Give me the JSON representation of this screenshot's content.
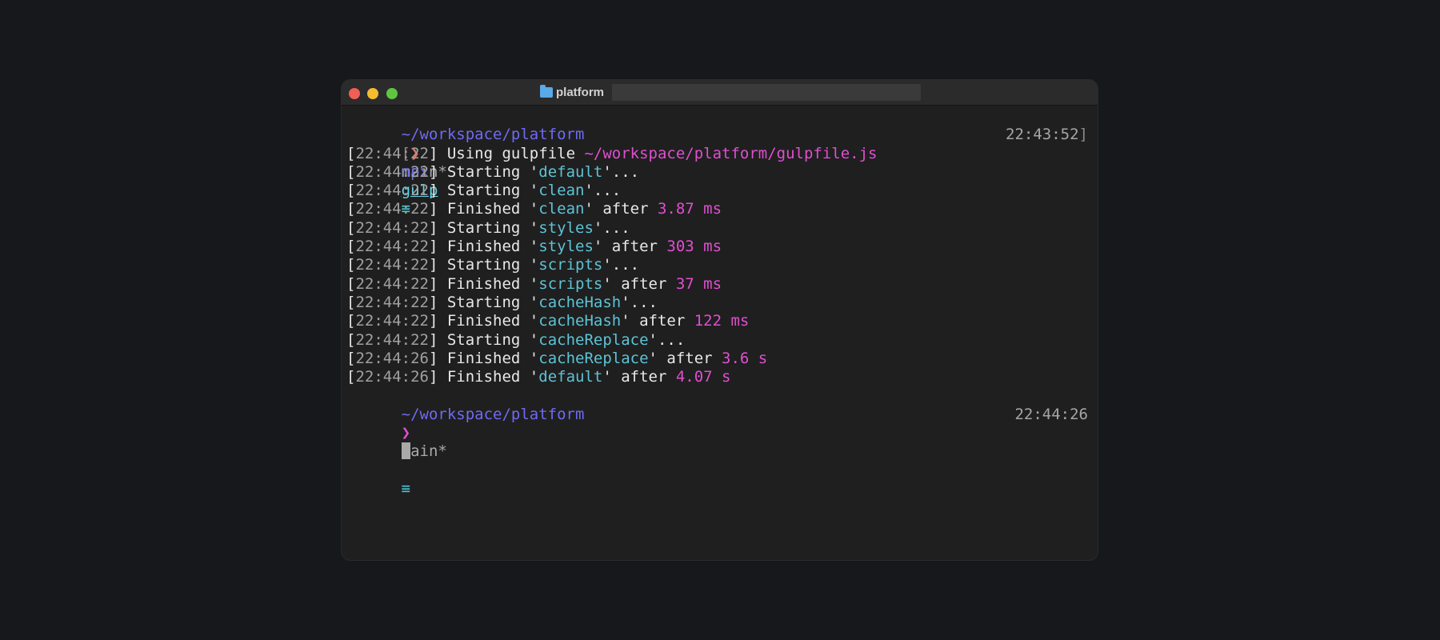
{
  "window": {
    "title": "platform",
    "colors": {
      "background": "#1f1f1f",
      "titlebar": "#2b2b2c",
      "path": "#6f6af2",
      "task": "#5dc3d6",
      "duration": "#e04fd0",
      "timestamp": "#a0a0a0"
    }
  },
  "terminal": {
    "prompt1": {
      "path": "~/workspace/platform",
      "branch": "main*",
      "status_glyph": "≡"
    },
    "command_line": {
      "bracket": "[",
      "arrow": "❯",
      "cmd": "npx",
      "arg": "gulp",
      "time": "22:43:52",
      "time_tail": "]"
    },
    "log": [
      {
        "ts": "22:44:22",
        "parts": [
          {
            "t": "Using gulpfile ",
            "c": "plain"
          },
          {
            "t": "~/workspace/platform/gulpfile.js",
            "c": "file"
          }
        ]
      },
      {
        "ts": "22:44:22",
        "parts": [
          {
            "t": "Starting '",
            "c": "plain"
          },
          {
            "t": "default",
            "c": "task"
          },
          {
            "t": "'...",
            "c": "plain"
          }
        ]
      },
      {
        "ts": "22:44:22",
        "parts": [
          {
            "t": "Starting '",
            "c": "plain"
          },
          {
            "t": "clean",
            "c": "task"
          },
          {
            "t": "'...",
            "c": "plain"
          }
        ]
      },
      {
        "ts": "22:44:22",
        "parts": [
          {
            "t": "Finished '",
            "c": "plain"
          },
          {
            "t": "clean",
            "c": "task"
          },
          {
            "t": "' after ",
            "c": "plain"
          },
          {
            "t": "3.87 ms",
            "c": "dur"
          }
        ]
      },
      {
        "ts": "22:44:22",
        "parts": [
          {
            "t": "Starting '",
            "c": "plain"
          },
          {
            "t": "styles",
            "c": "task"
          },
          {
            "t": "'...",
            "c": "plain"
          }
        ]
      },
      {
        "ts": "22:44:22",
        "parts": [
          {
            "t": "Finished '",
            "c": "plain"
          },
          {
            "t": "styles",
            "c": "task"
          },
          {
            "t": "' after ",
            "c": "plain"
          },
          {
            "t": "303 ms",
            "c": "dur"
          }
        ]
      },
      {
        "ts": "22:44:22",
        "parts": [
          {
            "t": "Starting '",
            "c": "plain"
          },
          {
            "t": "scripts",
            "c": "task"
          },
          {
            "t": "'...",
            "c": "plain"
          }
        ]
      },
      {
        "ts": "22:44:22",
        "parts": [
          {
            "t": "Finished '",
            "c": "plain"
          },
          {
            "t": "scripts",
            "c": "task"
          },
          {
            "t": "' after ",
            "c": "plain"
          },
          {
            "t": "37 ms",
            "c": "dur"
          }
        ]
      },
      {
        "ts": "22:44:22",
        "parts": [
          {
            "t": "Starting '",
            "c": "plain"
          },
          {
            "t": "cacheHash",
            "c": "task"
          },
          {
            "t": "'...",
            "c": "plain"
          }
        ]
      },
      {
        "ts": "22:44:22",
        "parts": [
          {
            "t": "Finished '",
            "c": "plain"
          },
          {
            "t": "cacheHash",
            "c": "task"
          },
          {
            "t": "' after ",
            "c": "plain"
          },
          {
            "t": "122 ms",
            "c": "dur"
          }
        ]
      },
      {
        "ts": "22:44:22",
        "parts": [
          {
            "t": "Starting '",
            "c": "plain"
          },
          {
            "t": "cacheReplace",
            "c": "task"
          },
          {
            "t": "'...",
            "c": "plain"
          }
        ]
      },
      {
        "ts": "22:44:26",
        "parts": [
          {
            "t": "Finished '",
            "c": "plain"
          },
          {
            "t": "cacheReplace",
            "c": "task"
          },
          {
            "t": "' after ",
            "c": "plain"
          },
          {
            "t": "3.6 s",
            "c": "dur"
          }
        ]
      },
      {
        "ts": "22:44:26",
        "parts": [
          {
            "t": "Finished '",
            "c": "plain"
          },
          {
            "t": "default",
            "c": "task"
          },
          {
            "t": "' after ",
            "c": "plain"
          },
          {
            "t": "4.07 s",
            "c": "dur"
          }
        ]
      }
    ],
    "prompt2": {
      "path": "~/workspace/platform",
      "branch": "main*",
      "status_glyph": "≡"
    },
    "input_line": {
      "arrow": "❯",
      "time": "22:44:26"
    }
  }
}
